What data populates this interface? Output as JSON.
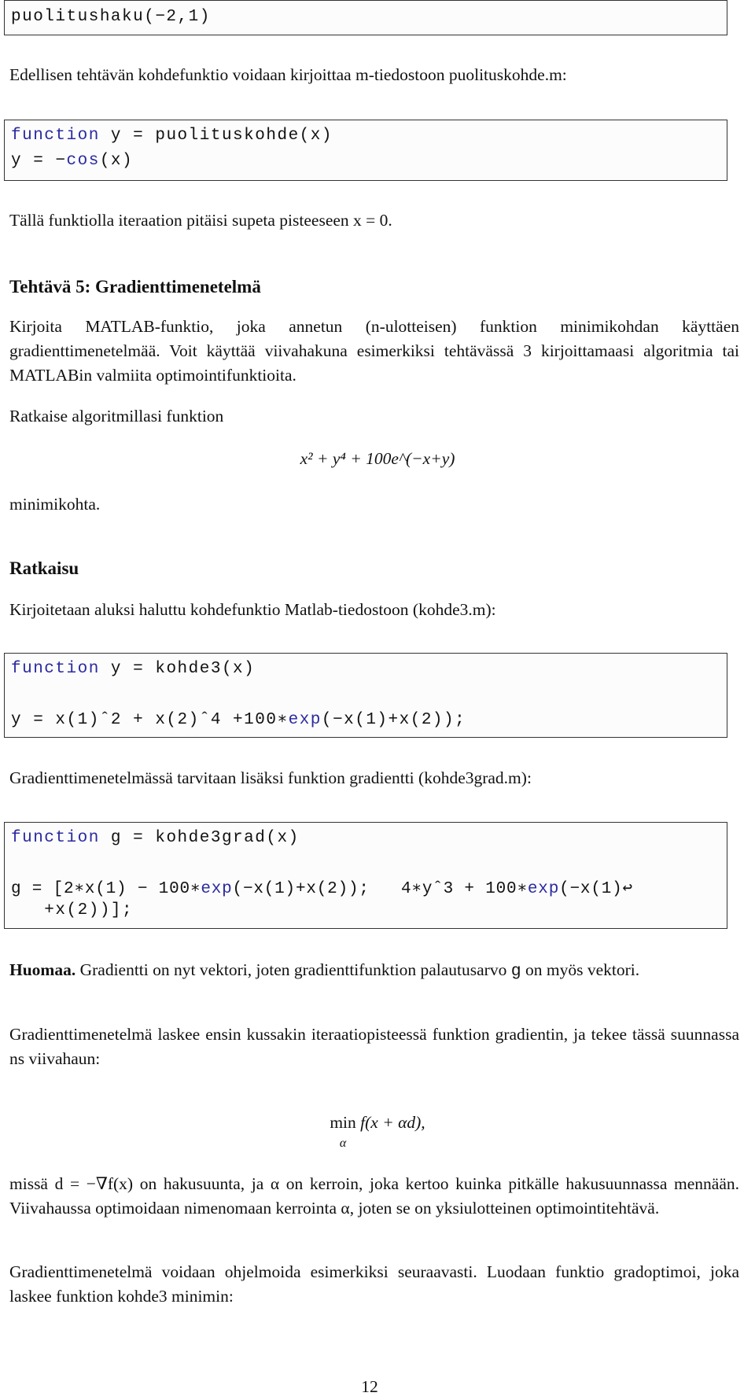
{
  "code1": "puolitushaku(−2,1)",
  "p1": "Edellisen tehtävän kohdefunktio voidaan kirjoittaa m-tiedostoon puolituskohde.m:",
  "code2": {
    "kw": "function",
    "l1": " y = puolituskohde(x)",
    "l2a": "y = −",
    "l2kw": "cos",
    "l2b": "(x)"
  },
  "p2": "Tällä funktiolla iteraation pitäisi supeta pisteeseen x = 0.",
  "h1": "Tehtävä 5: Gradienttimenetelmä",
  "p3": "Kirjoita MATLAB-funktio, joka annetun (n-ulotteisen) funktion minimikohdan käyttäen gradienttimenetelmää. Voit käyttää viivahakuna esimerkiksi tehtävässä 3 kirjoittamaasi algoritmia tai MATLABin valmiita optimointifunktioita.",
  "p4": "Ratkaise algoritmillasi funktion",
  "formula1": "x² + y⁴ + 100e^(−x+y)",
  "p5": "minimikohta.",
  "h2": "Ratkaisu",
  "p6": "Kirjoitetaan aluksi haluttu kohdefunktio Matlab-tiedostoon (kohde3.m):",
  "code3": {
    "kw": "function",
    "l1": " y = kohde3(x)",
    "l2a": "y = x(1)ˆ2 + x(2)ˆ4 +100∗",
    "l2kw": "exp",
    "l2b": "(−x(1)+x(2));"
  },
  "p7": "Gradienttimenetelmässä tarvitaan lisäksi funktion gradientti (kohde3grad.m):",
  "code4": {
    "kw": "function",
    "l1": " g = kohde3grad(x)",
    "l2a": "g = [2∗x(1) − 100∗",
    "l2kw": "exp",
    "l2b": "(−x(1)+x(2));   4∗yˆ3 + 100∗",
    "l2kw2": "exp",
    "l2c": "(−x(1)↩",
    "l3": "   +x(2))];"
  },
  "p8a": "Huomaa.",
  "p8b": " Gradientti on nyt vektori, joten gradienttifunktion palautusarvo ",
  "p8code": "g",
  "p8c": " on myös vektori.",
  "p9": "Gradienttimenetelmä laskee ensin kussakin iteraatiopisteessä funktion gradientin, ja tekee tässä suunnassa ns viivahaun:",
  "formula2": {
    "min": "min",
    "sub": "α",
    "expr": "f(x + αd),"
  },
  "p10": "missä d = −∇f(x) on hakusuunta, ja α on kerroin, joka kertoo kuinka pitkälle hakusuunnassa mennään. Viivahaussa optimoidaan nimenomaan kerrointa α, joten se on yksiulotteinen optimointitehtävä.",
  "p11": "Gradienttimenetelmä voidaan ohjelmoida esimerkiksi seuraavasti. Luodaan funktio gradoptimoi, joka laskee funktion kohde3 minimin:",
  "page_number": "12"
}
